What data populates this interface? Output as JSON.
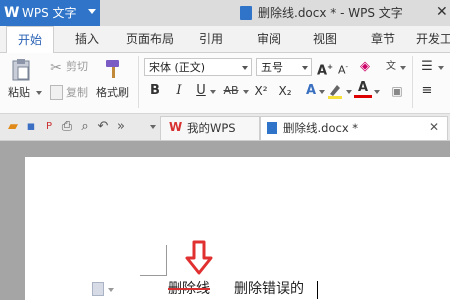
{
  "app": {
    "name": "WPS 文字",
    "logo": "W"
  },
  "window": {
    "title": "删除线.docx * - WPS 文字"
  },
  "ribbon_tabs": [
    "开始",
    "插入",
    "页面布局",
    "引用",
    "审阅",
    "视图",
    "章节",
    "开发工"
  ],
  "clipboard": {
    "paste": "粘贴",
    "cut": "剪切",
    "copy": "复制",
    "format_painter": "格式刷"
  },
  "font": {
    "family": "宋体 (正文)",
    "size": "五号"
  },
  "format_buttons": {
    "bold": "B",
    "italic": "I",
    "underline": "U",
    "strike": "AB",
    "superscript": "X²",
    "subscript": "X₂",
    "font_color": "A"
  },
  "doc_tabs": [
    {
      "label": "我的WPS"
    },
    {
      "label": "删除线.docx *"
    }
  ],
  "document": {
    "struck_text": "删除线",
    "normal_text": "删除错误的"
  },
  "colors": {
    "accent": "#2f74c8",
    "wps_red": "#d83030",
    "arrow_red": "#e03030",
    "highlight": "#f5e13a"
  }
}
